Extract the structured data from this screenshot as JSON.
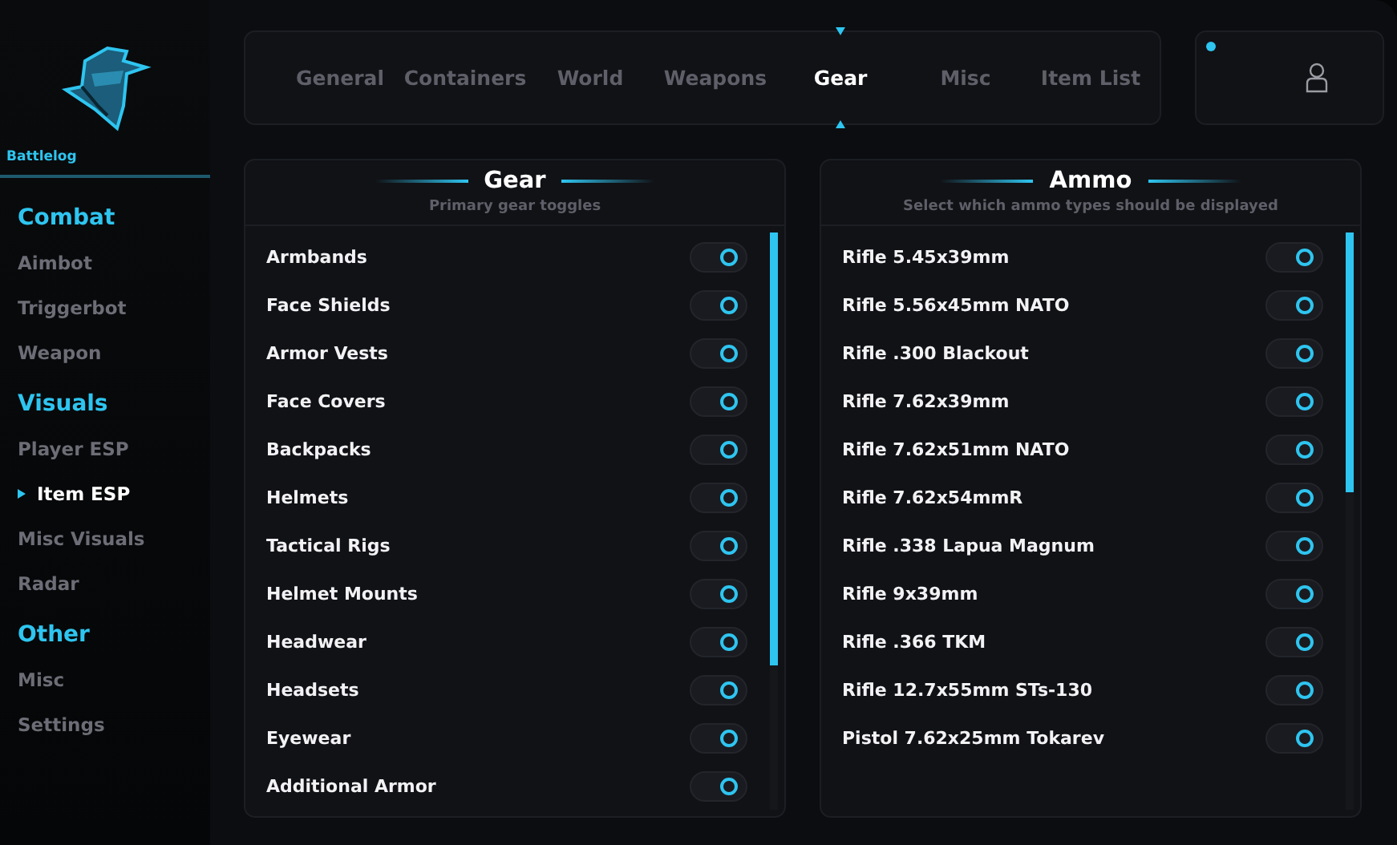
{
  "brand": {
    "name": "Battlelog"
  },
  "sidebar": {
    "sections": [
      {
        "title": "Combat",
        "items": [
          {
            "label": "Aimbot",
            "selected": false
          },
          {
            "label": "Triggerbot",
            "selected": false
          },
          {
            "label": "Weapon",
            "selected": false
          }
        ]
      },
      {
        "title": "Visuals",
        "items": [
          {
            "label": "Player ESP",
            "selected": false
          },
          {
            "label": "Item ESP",
            "selected": true
          },
          {
            "label": "Misc Visuals",
            "selected": false
          },
          {
            "label": "Radar",
            "selected": false
          }
        ]
      },
      {
        "title": "Other",
        "items": [
          {
            "label": "Misc",
            "selected": false
          },
          {
            "label": "Settings",
            "selected": false
          }
        ]
      }
    ]
  },
  "tabs": [
    {
      "label": "General",
      "selected": false
    },
    {
      "label": "Containers",
      "selected": false
    },
    {
      "label": "World",
      "selected": false
    },
    {
      "label": "Weapons",
      "selected": false
    },
    {
      "label": "Gear",
      "selected": true
    },
    {
      "label": "Misc",
      "selected": false
    },
    {
      "label": "Item List",
      "selected": false
    }
  ],
  "panels": [
    {
      "title": "Gear",
      "subtitle": "Primary gear toggles",
      "items": [
        {
          "label": "Armbands",
          "on": true
        },
        {
          "label": "Face Shields",
          "on": true
        },
        {
          "label": "Armor Vests",
          "on": true
        },
        {
          "label": "Face Covers",
          "on": true
        },
        {
          "label": "Backpacks",
          "on": true
        },
        {
          "label": "Helmets",
          "on": true
        },
        {
          "label": "Tactical Rigs",
          "on": true
        },
        {
          "label": "Helmet Mounts",
          "on": true
        },
        {
          "label": "Headwear",
          "on": true
        },
        {
          "label": "Headsets",
          "on": true
        },
        {
          "label": "Eyewear",
          "on": true
        },
        {
          "label": "Additional Armor",
          "on": true
        }
      ]
    },
    {
      "title": "Ammo",
      "subtitle": "Select which ammo types should be displayed",
      "items": [
        {
          "label": "Rifle 5.45x39mm",
          "on": true
        },
        {
          "label": "Rifle 5.56x45mm NATO",
          "on": true
        },
        {
          "label": "Rifle .300 Blackout",
          "on": true
        },
        {
          "label": "Rifle 7.62x39mm",
          "on": true
        },
        {
          "label": "Rifle 7.62x51mm NATO",
          "on": true
        },
        {
          "label": "Rifle 7.62x54mmR",
          "on": true
        },
        {
          "label": "Rifle .338 Lapua Magnum",
          "on": true
        },
        {
          "label": "Rifle 9x39mm",
          "on": true
        },
        {
          "label": "Rifle .366 TKM",
          "on": true
        },
        {
          "label": "Rifle 12.7x55mm STs-130",
          "on": true
        },
        {
          "label": "Pistol 7.62x25mm Tokarev",
          "on": true
        }
      ]
    }
  ]
}
